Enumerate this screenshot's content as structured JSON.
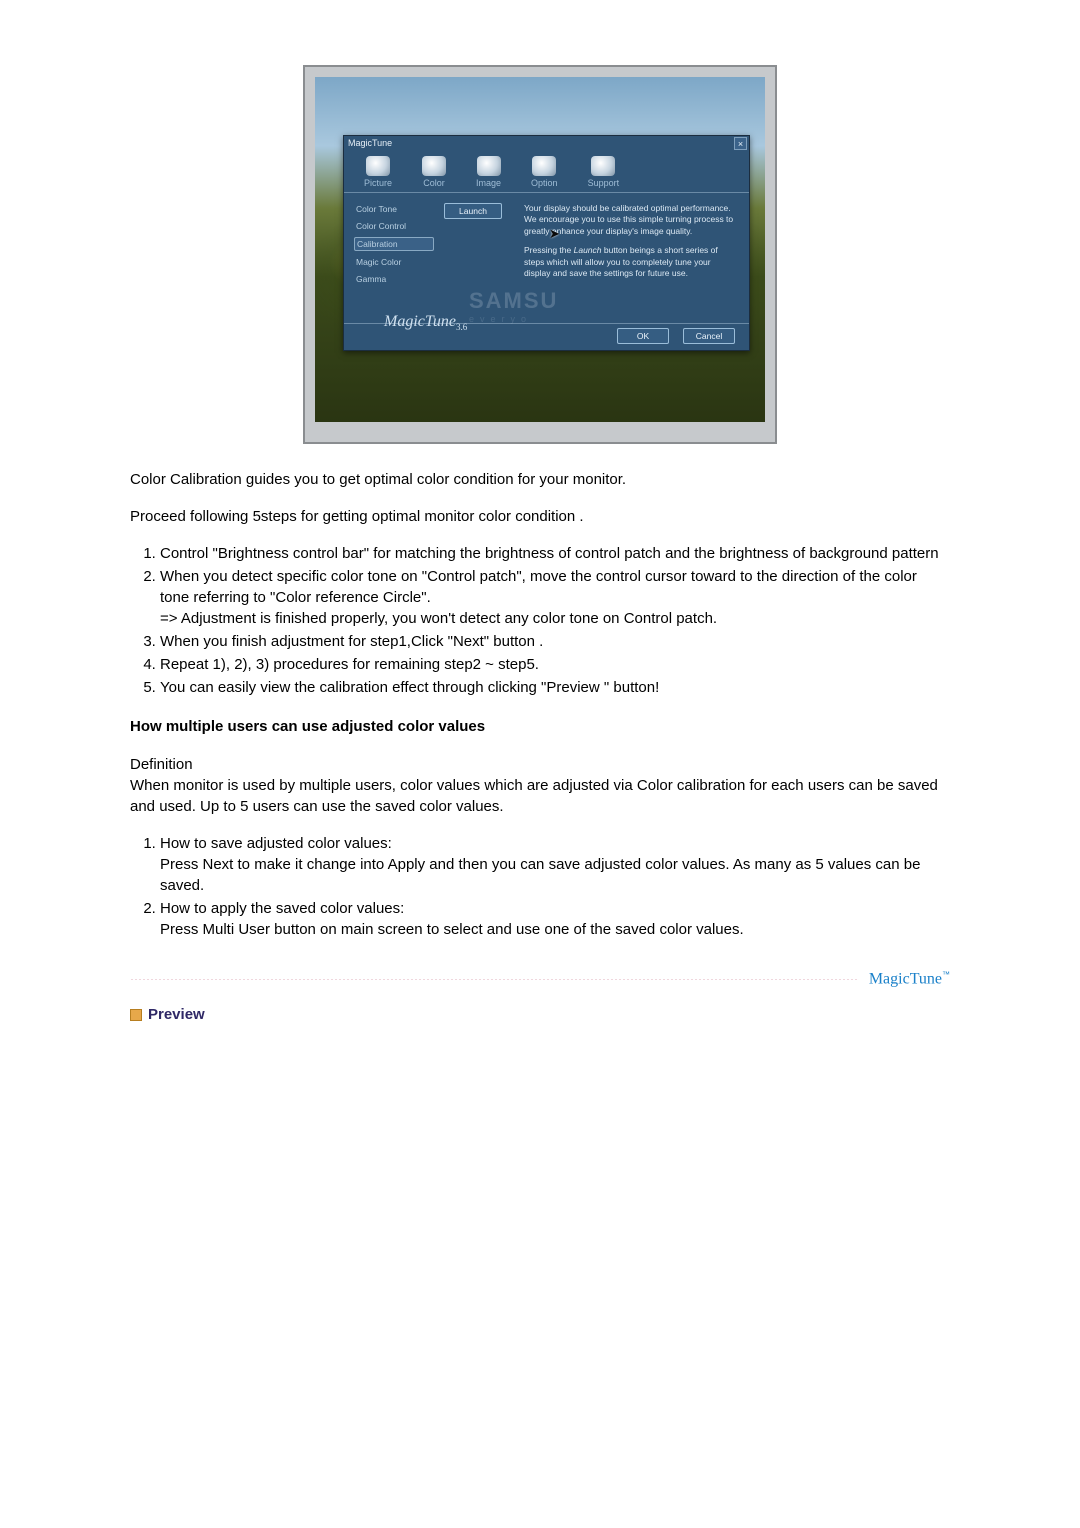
{
  "screenshot": {
    "title": "MagicTune",
    "tabs": [
      "Picture",
      "Color",
      "Image",
      "Option",
      "Support"
    ],
    "sidebar": {
      "items": [
        "Color Tone",
        "Color Control",
        "Calibration",
        "Magic Color",
        "Gamma"
      ],
      "active_index": 2
    },
    "launch_label": "Launch",
    "info_para1": "Your display should be calibrated optimal performance. We encourage you to use this simple turning process to greatly enhance your display's image quality.",
    "info_para2_prefix": "Pressing the ",
    "info_para2_italic": "Launch",
    "info_para2_suffix": " button beings a short series of steps which will allow you to completely tune your display and save the settings for future use.",
    "watermark_big": "SAMSU",
    "watermark_small": "everyo",
    "logo": "MagicTune",
    "logo_ver": "3.6",
    "ok_label": "OK",
    "cancel_label": "Cancel"
  },
  "doc": {
    "intro1": "Color Calibration guides you to get optimal color condition for your monitor.",
    "intro2": "Proceed following 5steps for getting optimal monitor color condition .",
    "steps": [
      "Control \"Brightness control bar\" for matching the brightness of control patch and the brightness of background pattern",
      "When you detect specific color tone on \"Control patch\", move the control cursor toward to the direction of the color tone referring to \"Color reference Circle\".\n=> Adjustment is finished properly, you won't detect any color tone on Control patch.",
      "When you finish adjustment for step1,Click \"Next\" button .",
      "Repeat 1), 2), 3) procedures for remaining step2 ~ step5.",
      "You can easily view the calibration effect through clicking \"Preview \" button!"
    ],
    "multiuser_heading": "How multiple users can use adjusted color values",
    "definition_label": "Definition",
    "definition_text": "When monitor is used by multiple users, color values which are adjusted via Color calibration for each users can be saved and used. Up to 5 users can use the saved color values.",
    "howto": [
      {
        "title": "How to save adjusted color values:",
        "body": "Press Next to make it change into Apply and then you can save adjusted color values. As many as 5 values can be saved."
      },
      {
        "title": "How to apply the saved color values:",
        "body": "Press Multi User button on main screen to select and use one of the saved color values."
      }
    ],
    "brand": "MagicTune",
    "preview_label": "Preview"
  }
}
